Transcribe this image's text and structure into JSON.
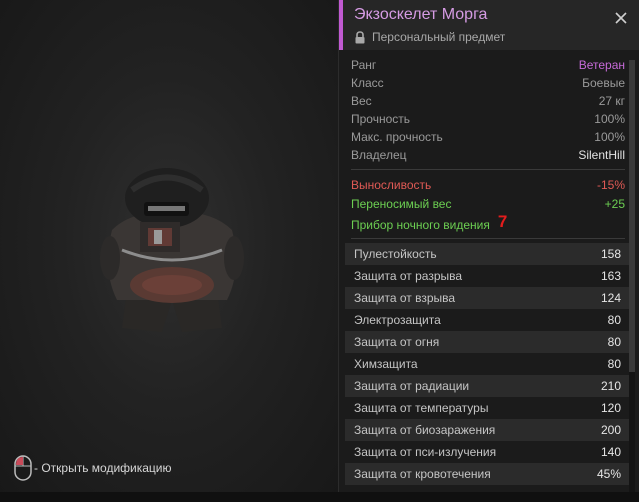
{
  "hint": {
    "text": "- Открыть модификацию",
    "icon": "mouse-icon"
  },
  "item": {
    "name": "Экзоскелет Морга",
    "type": "Персональный предмет",
    "accent_color": "#c15ad2"
  },
  "info": [
    {
      "label": "Ранг",
      "value": "Ветеран"
    },
    {
      "label": "Класс",
      "value": "Боевые"
    },
    {
      "label": "Вес",
      "value": "27 кг"
    },
    {
      "label": "Прочность",
      "value": "100%"
    },
    {
      "label": "Макс. прочность",
      "value": "100%"
    },
    {
      "label": "Владелец",
      "value": "SilentHill"
    }
  ],
  "effects": [
    {
      "label": "Выносливость",
      "value": "-15%"
    },
    {
      "label": "Переносимый вес",
      "value": "+25"
    },
    {
      "label": "Прибор ночного видения",
      "value": ""
    }
  ],
  "annotation": "7",
  "stats": [
    {
      "label": "Пулестойкость",
      "value": "158"
    },
    {
      "label": "Защита от разрыва",
      "value": "163"
    },
    {
      "label": "Защита от взрыва",
      "value": "124"
    },
    {
      "label": "Электрозащита",
      "value": "80"
    },
    {
      "label": "Защита от огня",
      "value": "80"
    },
    {
      "label": "Химзащита",
      "value": "80"
    },
    {
      "label": "Защита от радиации",
      "value": "210"
    },
    {
      "label": "Защита от температуры",
      "value": "120"
    },
    {
      "label": "Защита от биозаражения",
      "value": "200"
    },
    {
      "label": "Защита от пси-излучения",
      "value": "140"
    },
    {
      "label": "Защита от кровотечения",
      "value": "45%"
    }
  ],
  "colors": {
    "rank": "#c66ad8",
    "negative": "#e05a55",
    "positive": "#6ccf52"
  }
}
